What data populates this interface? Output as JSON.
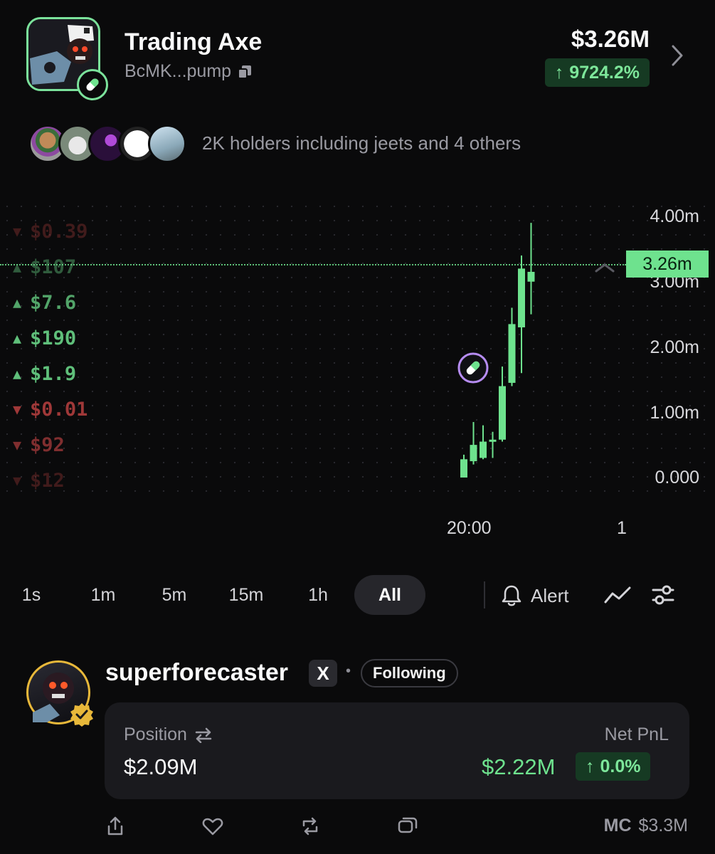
{
  "token": {
    "name": "Trading Axe",
    "address": "BcMK...pump",
    "market_cap": "$3.26M",
    "change": "9724.2%"
  },
  "holders": {
    "text": "2K holders including jeets and 4 others"
  },
  "trades": [
    {
      "dir": "down",
      "amount": "$0.39",
      "opacity": 0.35
    },
    {
      "dir": "up",
      "amount": "$107",
      "opacity": 0.45
    },
    {
      "dir": "up",
      "amount": "$7.6",
      "opacity": 0.85
    },
    {
      "dir": "up",
      "amount": "$190",
      "opacity": 1.0
    },
    {
      "dir": "up",
      "amount": "$1.9",
      "opacity": 1.0
    },
    {
      "dir": "down",
      "amount": "$0.01",
      "opacity": 0.95
    },
    {
      "dir": "down",
      "amount": "$92",
      "opacity": 0.75
    },
    {
      "dir": "down",
      "amount": "$12",
      "opacity": 0.35
    }
  ],
  "chart_data": {
    "type": "candlestick",
    "y_ticks": [
      "4.00m",
      "3.00m",
      "2.00m",
      "1.00m",
      "0.000"
    ],
    "x_ticks": [
      "20:00",
      "1"
    ],
    "current_price_label": "3.26m",
    "current_price": 3.26,
    "ylim": [
      0,
      4.0
    ],
    "candles": [
      {
        "o": 0.0,
        "c": 0.28,
        "h": 0.35,
        "l": 0.0
      },
      {
        "o": 0.25,
        "c": 0.5,
        "h": 0.85,
        "l": 0.2
      },
      {
        "o": 0.3,
        "c": 0.55,
        "h": 0.8,
        "l": 0.28
      },
      {
        "o": 0.55,
        "c": 0.58,
        "h": 0.7,
        "l": 0.3
      },
      {
        "o": 0.58,
        "c": 1.4,
        "h": 1.7,
        "l": 0.55
      },
      {
        "o": 1.45,
        "c": 2.35,
        "h": 2.6,
        "l": 1.4
      },
      {
        "o": 2.3,
        "c": 3.2,
        "h": 3.4,
        "l": 1.6
      },
      {
        "o": 3.15,
        "c": 3.0,
        "h": 3.9,
        "l": 2.5
      }
    ]
  },
  "timeframes": [
    "1s",
    "1m",
    "5m",
    "15m",
    "1h",
    "All"
  ],
  "active_timeframe": "All",
  "alert_label": "Alert",
  "post": {
    "username": "superforecaster",
    "x_label": "X",
    "follow_label": "Following",
    "position_label": "Position",
    "position_value": "$2.09M",
    "pnl_label": "Net PnL",
    "pnl_value": "$2.22M",
    "pnl_change": "0.0%",
    "mc_label": "MC",
    "mc_value": "$3.3M"
  },
  "colors": {
    "accent_green": "#6ee28e",
    "down_red": "#a83b3b",
    "verified_gold": "#e8b83a",
    "marker_purple": "#b68cf2"
  }
}
